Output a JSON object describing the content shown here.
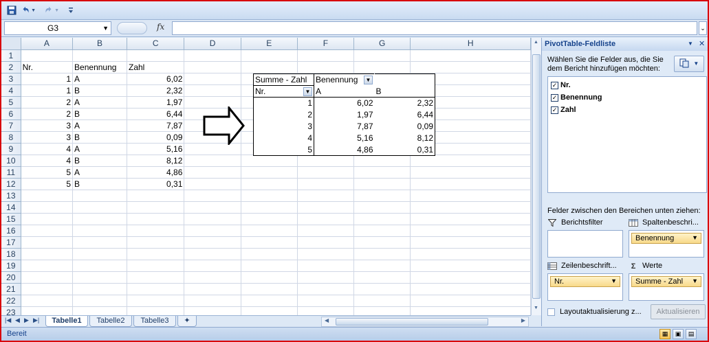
{
  "formula_bar": {
    "name_box": "G3",
    "fx_label": "fx",
    "formula": ""
  },
  "columns": [
    "A",
    "B",
    "C",
    "D",
    "E",
    "F",
    "G",
    "H"
  ],
  "rows": [
    {
      "n": "1",
      "a": "",
      "b": "",
      "c": ""
    },
    {
      "n": "2",
      "a": "Nr.",
      "b": "Benennung",
      "c": "Zahl"
    },
    {
      "n": "3",
      "a": "1",
      "b": "A",
      "c": "6,02"
    },
    {
      "n": "4",
      "a": "1",
      "b": "B",
      "c": "2,32"
    },
    {
      "n": "5",
      "a": "2",
      "b": "A",
      "c": "1,97"
    },
    {
      "n": "6",
      "a": "2",
      "b": "B",
      "c": "6,44"
    },
    {
      "n": "7",
      "a": "3",
      "b": "A",
      "c": "7,87"
    },
    {
      "n": "8",
      "a": "3",
      "b": "B",
      "c": "0,09"
    },
    {
      "n": "9",
      "a": "4",
      "b": "A",
      "c": "5,16"
    },
    {
      "n": "10",
      "a": "4",
      "b": "B",
      "c": "8,12"
    },
    {
      "n": "11",
      "a": "5",
      "b": "A",
      "c": "4,86"
    },
    {
      "n": "12",
      "a": "5",
      "b": "B",
      "c": "0,31"
    },
    {
      "n": "13"
    },
    {
      "n": "14"
    },
    {
      "n": "15"
    },
    {
      "n": "16"
    },
    {
      "n": "17"
    },
    {
      "n": "18"
    },
    {
      "n": "19"
    },
    {
      "n": "20"
    },
    {
      "n": "21"
    },
    {
      "n": "22"
    },
    {
      "n": "23"
    }
  ],
  "pivot": {
    "data_field": "Summe - Zahl",
    "column_field": "Benennung",
    "row_field": "Nr.",
    "col_items": [
      "A",
      "B"
    ],
    "rows": [
      {
        "nr": "1",
        "a": "6,02",
        "b": "2,32"
      },
      {
        "nr": "2",
        "a": "1,97",
        "b": "6,44"
      },
      {
        "nr": "3",
        "a": "7,87",
        "b": "0,09"
      },
      {
        "nr": "4",
        "a": "5,16",
        "b": "8,12"
      },
      {
        "nr": "5",
        "a": "4,86",
        "b": "0,31"
      }
    ]
  },
  "sheet_tabs": [
    "Tabelle1",
    "Tabelle2",
    "Tabelle3"
  ],
  "panel": {
    "title": "PivotTable-Feldliste",
    "description": "Wählen Sie die Felder aus, die Sie dem Bericht hinzufügen möchten:",
    "fields": [
      {
        "label": "Nr.",
        "checked": true
      },
      {
        "label": "Benennung",
        "checked": true
      },
      {
        "label": "Zahl",
        "checked": true
      }
    ],
    "drag_label": "Felder zwischen den Bereichen unten ziehen:",
    "areas": {
      "report_filter": "Berichtsfilter",
      "column_labels": "Spaltenbeschri...",
      "row_labels": "Zeilenbeschrift...",
      "values": "Werte"
    },
    "column_chip": "Benennung",
    "row_chip": "Nr.",
    "values_chip": "Summe - Zahl",
    "defer_label": "Layoutaktualisierung z...",
    "update_button": "Aktualisieren"
  },
  "status": {
    "text": "Bereit"
  },
  "icons": [
    "save-icon",
    "undo-icon",
    "redo-icon",
    "customize-icon",
    "fx-icon",
    "filter-icon",
    "column-labels-icon",
    "row-labels-icon",
    "sigma-icon",
    "arrow-right-icon"
  ]
}
